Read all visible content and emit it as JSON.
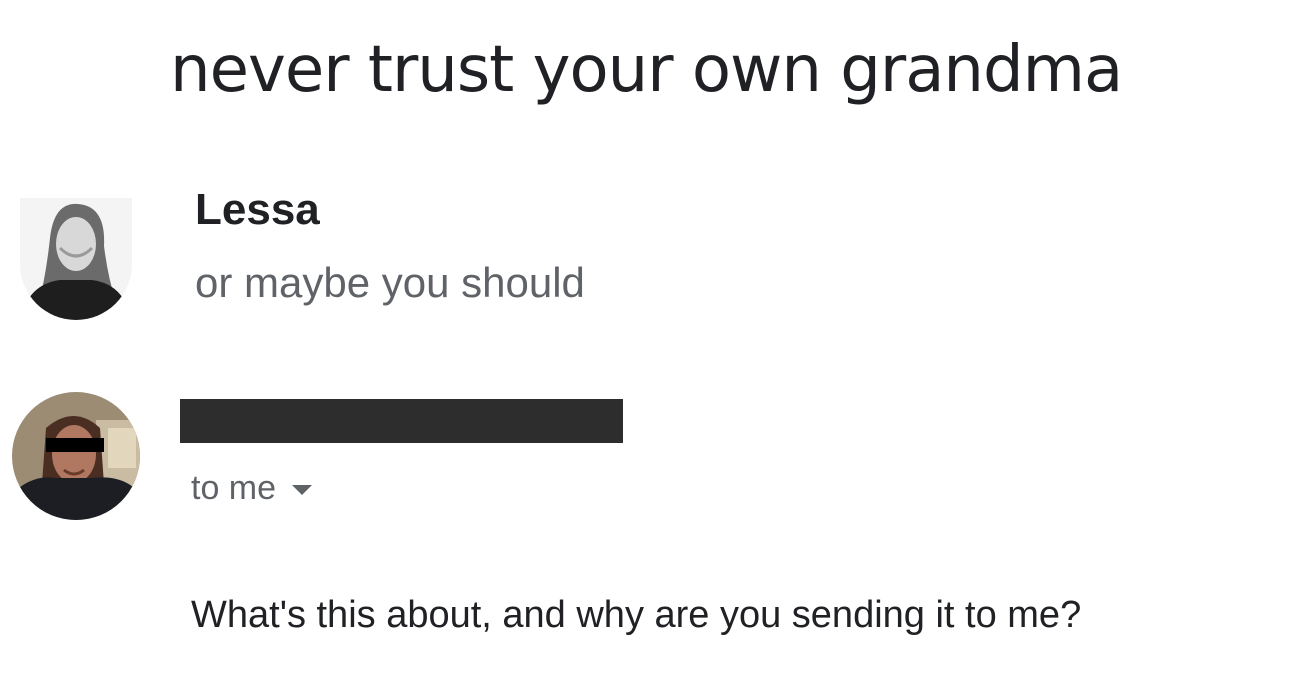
{
  "email": {
    "subject": "never trust your own grandma"
  },
  "messages": [
    {
      "sender_name": "Lessa",
      "snippet": "or maybe you should",
      "avatar_icon": "avatar-photo-icon"
    },
    {
      "sender_name_redacted": true,
      "recipient_label": "to me",
      "recipient_dropdown_icon": "caret-down-icon",
      "body": "What's this about, and why are you sending it to me?",
      "avatar_icon": "avatar-photo-icon"
    }
  ],
  "colors": {
    "text_primary": "#202124",
    "text_secondary": "#5f6368",
    "redaction": "#2d2d2d",
    "background": "#ffffff"
  }
}
